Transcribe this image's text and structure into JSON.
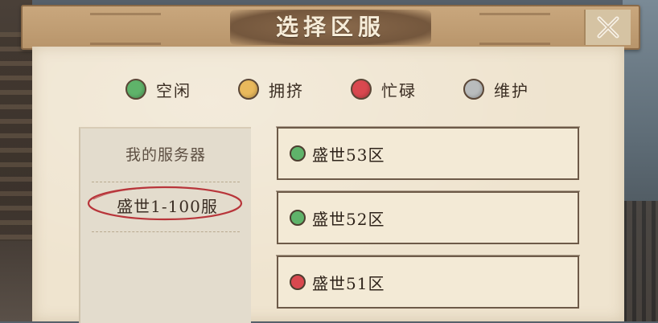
{
  "title": "选择区服",
  "legend": [
    {
      "label": "空闲",
      "color": "#5fb36a"
    },
    {
      "label": "拥挤",
      "color": "#e9b95c"
    },
    {
      "label": "忙碌",
      "color": "#d9484f"
    },
    {
      "label": "维护",
      "color": "#b9bcbd"
    }
  ],
  "sidebar": {
    "header": "我的服务器",
    "groups": [
      {
        "label": "盛世1-100服"
      }
    ]
  },
  "servers": [
    {
      "name": "盛世53区",
      "status_color": "#5fb36a"
    },
    {
      "name": "盛世52区",
      "status_color": "#5fb36a"
    },
    {
      "name": "盛世51区",
      "status_color": "#d9484f"
    }
  ]
}
